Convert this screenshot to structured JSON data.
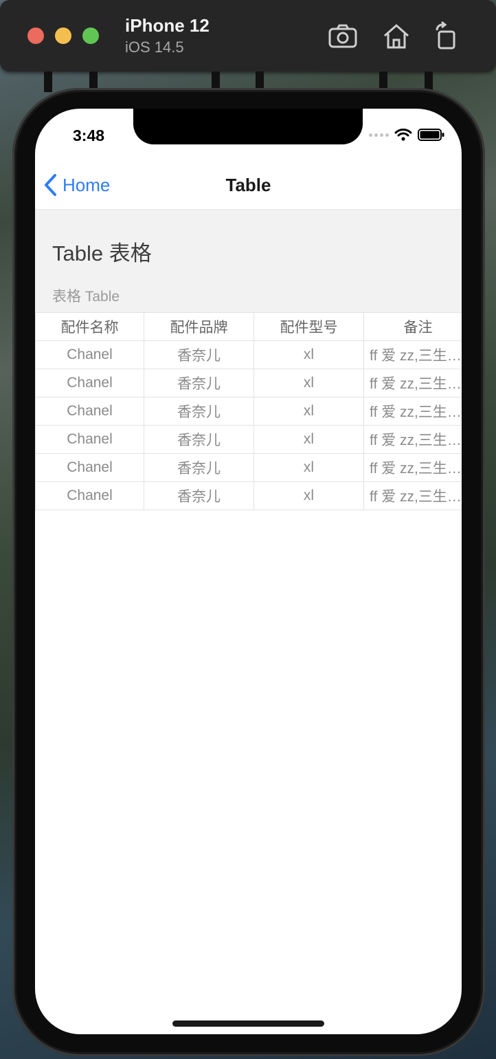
{
  "simulator": {
    "device_name": "iPhone 12",
    "os_version": "iOS 14.5",
    "buttons": [
      "screenshot-icon",
      "home-icon",
      "rotate-icon"
    ]
  },
  "status_bar": {
    "time": "3:48"
  },
  "nav": {
    "back_label": "Home",
    "title": "Table"
  },
  "page": {
    "heading": "Table 表格",
    "subheading": "表格 Table"
  },
  "table": {
    "headers": [
      "配件名称",
      "配件品牌",
      "配件型号",
      "备注"
    ],
    "rows": [
      [
        "Chanel",
        "香奈儿",
        "xl",
        "ff 爱 zz,三生三世"
      ],
      [
        "Chanel",
        "香奈儿",
        "xl",
        "ff 爱 zz,三生三世"
      ],
      [
        "Chanel",
        "香奈儿",
        "xl",
        "ff 爱 zz,三生三世"
      ],
      [
        "Chanel",
        "香奈儿",
        "xl",
        "ff 爱 zz,三生三世"
      ],
      [
        "Chanel",
        "香奈儿",
        "xl",
        "ff 爱 zz,三生三世"
      ],
      [
        "Chanel",
        "香奈儿",
        "xl",
        "ff 爱 zz,三生三世"
      ]
    ]
  },
  "colors": {
    "accent": "#2f7df6",
    "header_bg": "#f2f2f2"
  }
}
